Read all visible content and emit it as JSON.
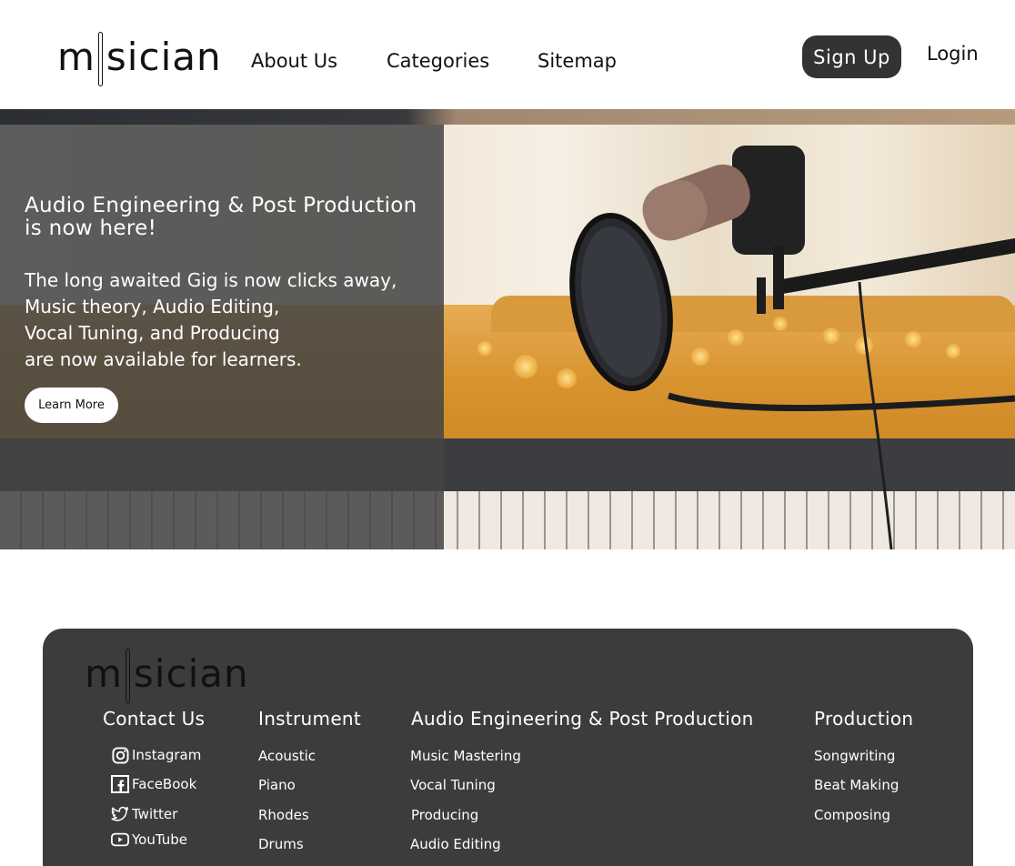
{
  "header": {
    "logo_left": "m",
    "logo_right": "sician",
    "nav": [
      "About Us",
      "Categories",
      "Sitemap"
    ],
    "signup_label": "Sign Up",
    "login_label": "Login"
  },
  "hero": {
    "headline": "Audio Engineering & Post Production is now here!",
    "description_lines": [
      "The long awaited Gig is now clicks away,",
      "Music theory, Audio Editing,",
      "Vocal Tuning, and Producing",
      "are now available for learners."
    ],
    "cta_label": "Learn More"
  },
  "footer": {
    "logo_left": "m",
    "logo_right": "sician",
    "contact": {
      "title": "Contact Us",
      "links": [
        {
          "icon": "instagram-icon",
          "label": "Instagram"
        },
        {
          "icon": "facebook-icon",
          "label": "FaceBook"
        },
        {
          "icon": "twitter-icon",
          "label": "Twitter"
        },
        {
          "icon": "youtube-icon",
          "label": "YouTube"
        }
      ]
    },
    "instrument": {
      "title": "Instrument",
      "links": [
        "Acoustic",
        "Piano",
        "Rhodes",
        "Drums"
      ]
    },
    "audio": {
      "title": "Audio Engineering & Post Production",
      "links": [
        "Music Mastering",
        "Vocal Tuning",
        "Producing",
        "Audio Editing"
      ]
    },
    "production": {
      "title": "Production",
      "links": [
        "Songwriting",
        "Beat Making",
        "Composing"
      ]
    }
  },
  "colors": {
    "button_dark": "#333333",
    "footer_bg": "#3c3c3c",
    "hero_overlay": "#444444"
  }
}
